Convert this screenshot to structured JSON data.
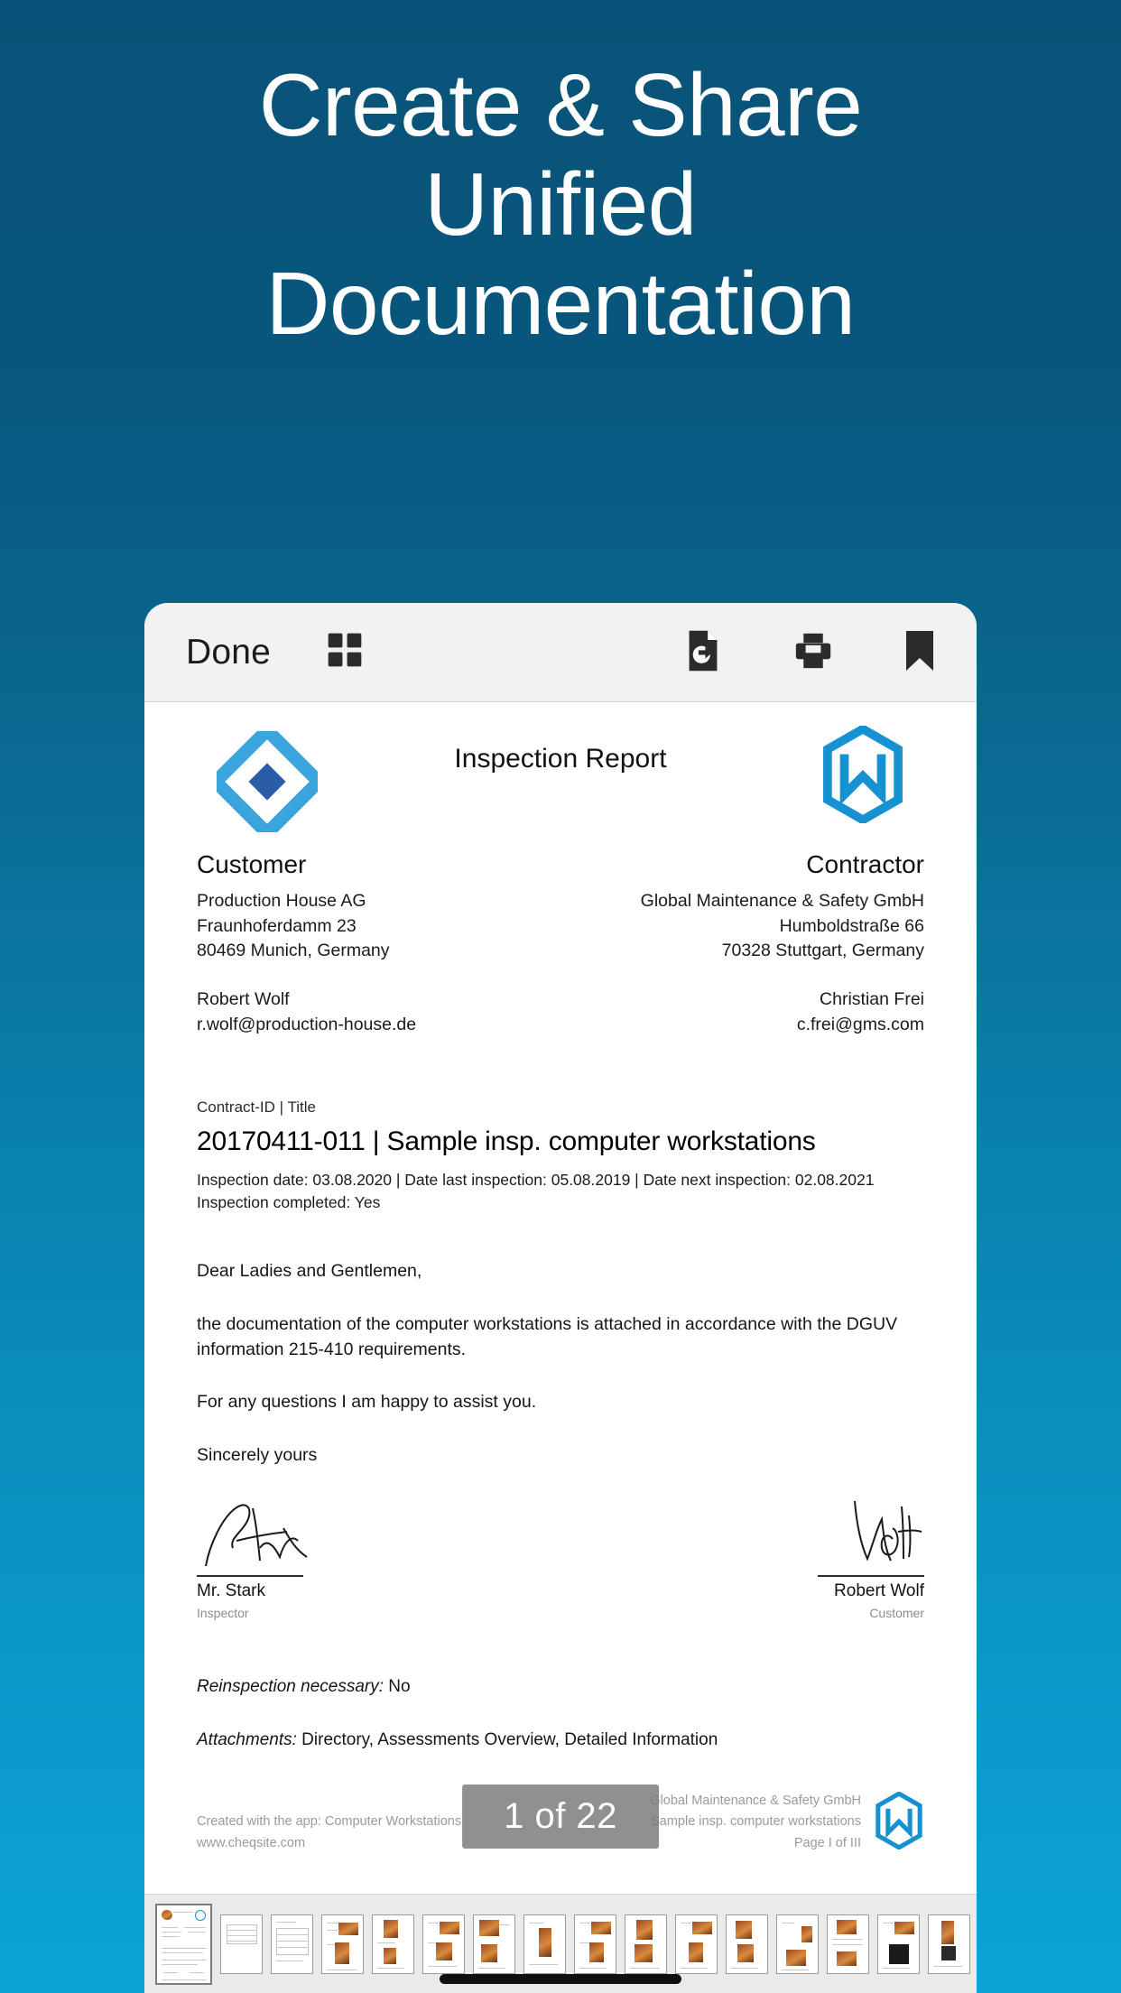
{
  "headline": {
    "line1": "Create & Share",
    "line2": "Unified",
    "line3": "Documentation"
  },
  "colors": {
    "bg_top": "#0a5378",
    "bg_bottom": "#0ba3d6",
    "logo_light_blue": "#3aa6dd",
    "logo_dark_blue": "#2b5ca8",
    "logo_m_blue": "#1592cf",
    "toolbar_bg": "#f2f2f2"
  },
  "toolbar": {
    "done_label": "Done",
    "grid_icon": "grid-icon",
    "export_icon": "export-icon",
    "print_icon": "print-icon",
    "bookmark_icon": "bookmark-icon"
  },
  "document": {
    "title": "Inspection Report",
    "customer": {
      "heading": "Customer",
      "company": "Production House AG",
      "street": "Fraunhoferdamm 23",
      "city": "80469 Munich, Germany",
      "contact": "Robert Wolf",
      "email": "r.wolf@production-house.de"
    },
    "contractor": {
      "heading": "Contractor",
      "company": "Global Maintenance & Safety GmbH",
      "street": "Humboldstraße 66",
      "city": "70328 Stuttgart, Germany",
      "contact": "Christian Frei",
      "email": "c.frei@gms.com"
    },
    "contract": {
      "label": "Contract-ID | Title",
      "title": "20170411-011 | Sample insp. computer workstations",
      "dates": "Inspection date: 03.08.2020 | Date last inspection: 05.08.2019 | Date next inspection: 02.08.2021",
      "completed": "Inspection completed: Yes"
    },
    "letter": {
      "salutation": "Dear Ladies and Gentlemen,",
      "body": "the documentation of the computer workstations is attached in accordance with the DGUV information 215-410 requirements.",
      "question": "For any questions I am happy to assist you.",
      "closing": "Sincerely yours"
    },
    "signatures": [
      {
        "name": "Mr. Stark",
        "role": "Inspector"
      },
      {
        "name": "Robert Wolf",
        "role": "Customer"
      }
    ],
    "notes": {
      "reinspection_label": "Reinspection necessary:",
      "reinspection_value": "No",
      "attachments_label": "Attachments:",
      "attachments_value": "Directory, Assessments Overview, Detailed Information"
    },
    "footer": {
      "created_with": "Created with the app: Computer Workstations",
      "website": "www.cheqsite.com",
      "company": "Global Maintenance & Safety GmbH",
      "doc_title": "Sample insp. computer workstations",
      "page_label": "Page I of III"
    },
    "page_badge": "1 of 22"
  }
}
